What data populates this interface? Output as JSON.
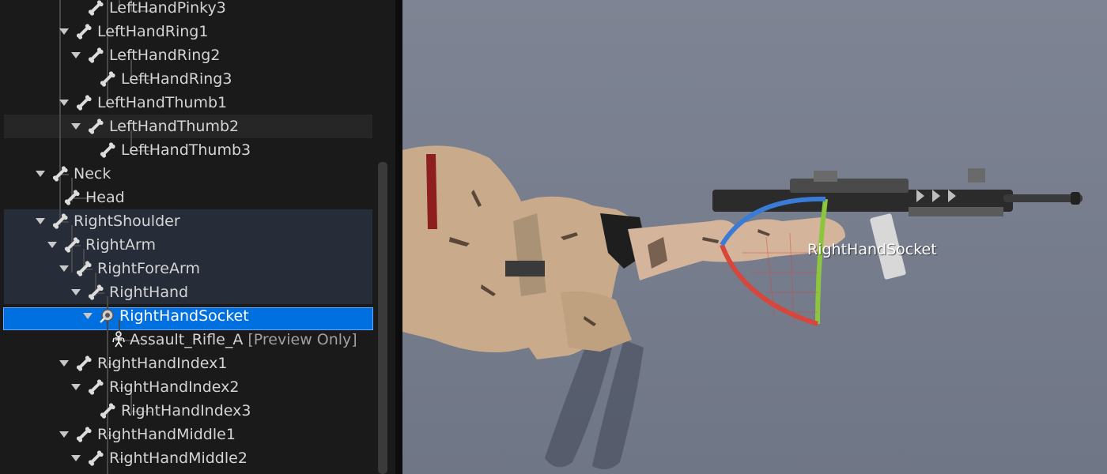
{
  "skeleton_tree": {
    "rows": [
      {
        "label": "LeftHandPinky3",
        "expanded": false,
        "type": "bone"
      },
      {
        "label": "LeftHandRing1",
        "expanded": true,
        "type": "bone"
      },
      {
        "label": "LeftHandRing2",
        "expanded": true,
        "type": "bone"
      },
      {
        "label": "LeftHandRing3",
        "expanded": false,
        "type": "bone"
      },
      {
        "label": "LeftHandThumb1",
        "expanded": true,
        "type": "bone"
      },
      {
        "label": "LeftHandThumb2",
        "expanded": true,
        "type": "bone",
        "hovered": true
      },
      {
        "label": "LeftHandThumb3",
        "expanded": false,
        "type": "bone"
      },
      {
        "label": "Neck",
        "expanded": true,
        "type": "bone"
      },
      {
        "label": "Head",
        "expanded": false,
        "type": "bone"
      },
      {
        "label": "RightShoulder",
        "expanded": true,
        "type": "bone",
        "highlighted": true
      },
      {
        "label": "RightArm",
        "expanded": true,
        "type": "bone",
        "highlighted": true
      },
      {
        "label": "RightForeArm",
        "expanded": true,
        "type": "bone",
        "highlighted": true
      },
      {
        "label": "RightHand",
        "expanded": true,
        "type": "bone",
        "highlighted": true
      },
      {
        "label": "RightHandSocket",
        "expanded": true,
        "type": "socket",
        "selected": true
      },
      {
        "label": "Assault_Rifle_A",
        "suffix": "[Preview Only]",
        "expanded": false,
        "type": "mesh"
      },
      {
        "label": "RightHandIndex1",
        "expanded": true,
        "type": "bone"
      },
      {
        "label": "RightHandIndex2",
        "expanded": true,
        "type": "bone"
      },
      {
        "label": "RightHandIndex3",
        "expanded": false,
        "type": "bone"
      },
      {
        "label": "RightHandMiddle1",
        "expanded": true,
        "type": "bone"
      },
      {
        "label": "RightHandMiddle2",
        "expanded": true,
        "type": "bone"
      }
    ]
  },
  "viewport": {
    "socket_label": "RightHandSocket"
  },
  "colors": {
    "selection": "#0070e0",
    "highlight": "#262d38",
    "hover": "#262626",
    "gizmo_x": "#d8453a",
    "gizmo_y": "#8cc63f",
    "gizmo_z": "#3a7bd5"
  }
}
